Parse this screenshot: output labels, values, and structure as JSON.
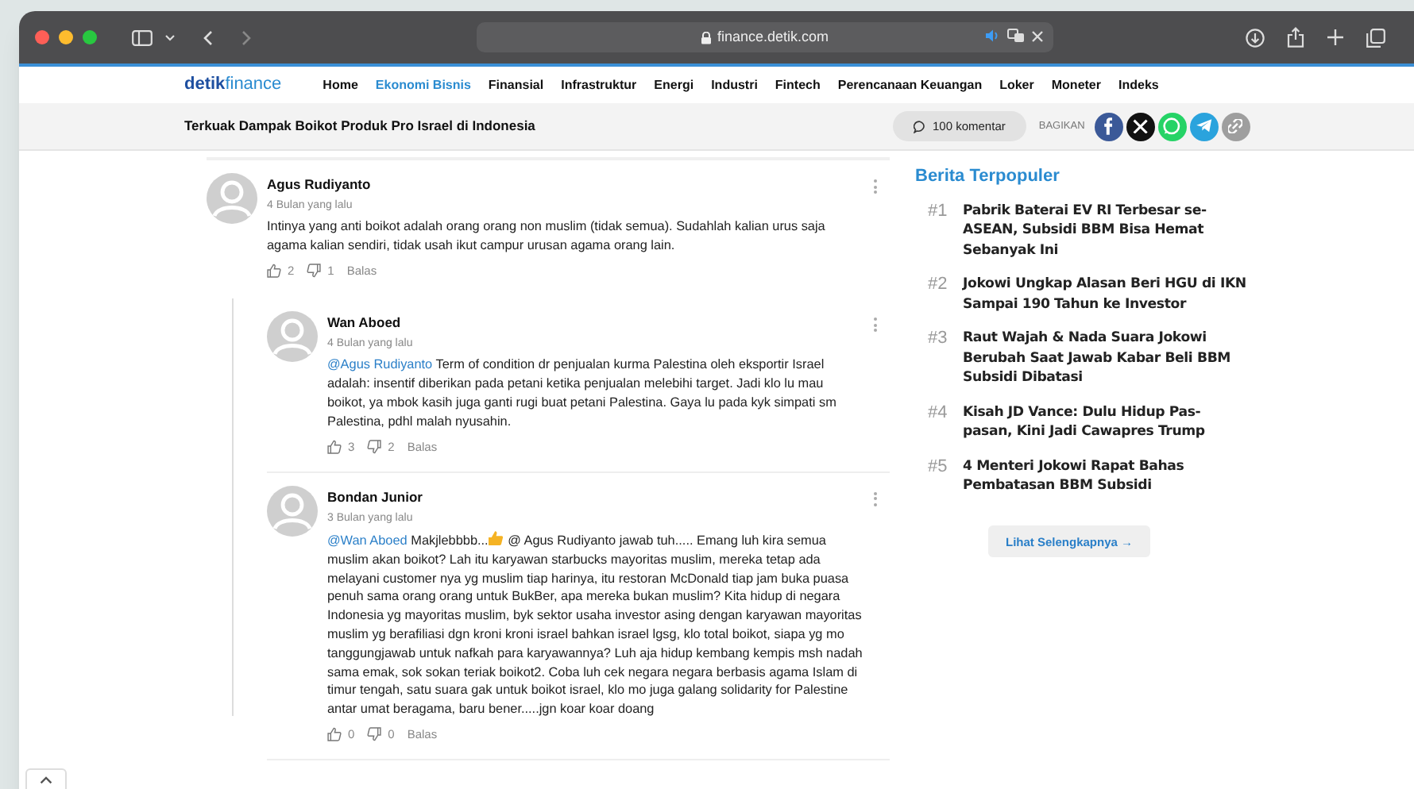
{
  "browser": {
    "url": "finance.detik.com"
  },
  "site": {
    "logo_bold": "detik",
    "logo_light": "finance",
    "nav": [
      {
        "label": "Home",
        "selected": false
      },
      {
        "label": "Ekonomi Bisnis",
        "selected": true
      },
      {
        "label": "Finansial",
        "selected": false
      },
      {
        "label": "Infrastruktur",
        "selected": false
      },
      {
        "label": "Energi",
        "selected": false
      },
      {
        "label": "Industri",
        "selected": false
      },
      {
        "label": "Fintech",
        "selected": false
      },
      {
        "label": "Perencanaan Keuangan",
        "selected": false
      },
      {
        "label": "Loker",
        "selected": false
      },
      {
        "label": "Moneter",
        "selected": false
      },
      {
        "label": "Indeks",
        "selected": false
      }
    ]
  },
  "article_bar": {
    "title": "Terkuak Dampak Boikot Produk Pro Israel di Indonesia",
    "comments_button": "100 komentar",
    "share_label": "BAGIKAN",
    "share_buttons": [
      {
        "kind": "facebook",
        "color": "#3b5998"
      },
      {
        "kind": "x",
        "color": "#111111"
      },
      {
        "kind": "whatsapp",
        "color": "#25d366"
      },
      {
        "kind": "telegram",
        "color": "#2aa3dd"
      },
      {
        "kind": "link",
        "color": "#9e9e9e"
      }
    ]
  },
  "comments": [
    {
      "author": "Agus Rudiyanto",
      "time": "4 Bulan yang lalu",
      "parts": [
        {
          "kind": "text",
          "text": "Intinya yang anti boikot adalah orang orang non muslim (tidak semua). Sudahlah kalian urus saja agama kalian sendiri, tidak usah ikut campur urusan agama orang lain."
        }
      ],
      "likes": "2",
      "dislikes": "1",
      "reply": "Balas",
      "replies": [
        {
          "author": "Wan Aboed",
          "time": "4 Bulan yang lalu",
          "parts": [
            {
              "kind": "mention",
              "text": "@Agus Rudiyanto"
            },
            {
              "kind": "text",
              "text": " Term of condition dr penjualan kurma Palestina oleh eksportir Israel adalah: insentif diberikan pada petani ketika penjualan melebihi target. Jadi klo lu mau boikot, ya mbok kasih juga ganti rugi buat petani Palestina. Gaya lu pada kyk simpati sm Palestina, pdhl malah nyusahin."
            }
          ],
          "likes": "3",
          "dislikes": "2",
          "reply": "Balas"
        },
        {
          "author": "Bondan Junior",
          "time": "3 Bulan yang lalu",
          "parts": [
            {
              "kind": "mention",
              "text": "@Wan Aboed"
            },
            {
              "kind": "text",
              "text": " Makjlebbbb..."
            },
            {
              "kind": "thumb"
            },
            {
              "kind": "text",
              "text": " @ Agus Rudiyanto jawab tuh..... Emang luh kira semua muslim akan boikot? Lah itu karyawan starbucks mayoritas muslim, mereka tetap ada melayani customer nya yg muslim tiap harinya, itu restoran McDonald tiap jam buka puasa penuh sama orang orang untuk BukBer, apa mereka bukan muslim? Kita hidup di negara Indonesia yg mayoritas muslim, byk sektor usaha investor asing dengan karyawan mayoritas muslim yg berafiliasi dgn kroni kroni israel bahkan israel lgsg, klo total boikot, siapa yg mo tanggungjawab untuk nafkah para karyawannya? Luh aja hidup kembang kempis msh nadah sama emak, sok sokan teriak boikot2. Coba luh cek negara negara berbasis agama Islam di timur tengah, satu suara gak untuk boikot israel, klo mo juga galang solidarity for Palestine antar umat beragama, baru bener.....jgn koar koar doang"
            }
          ],
          "likes": "0",
          "dislikes": "0",
          "reply": "Balas"
        }
      ]
    }
  ],
  "sidebar": {
    "title": "Berita Terpopuler",
    "items": [
      {
        "rank": "#1",
        "title": "Pabrik Baterai EV RI Terbesar se-ASEAN, Subsidi BBM Bisa Hemat Sebanyak Ini"
      },
      {
        "rank": "#2",
        "title": "Jokowi Ungkap Alasan Beri HGU di IKN Sampai 190 Tahun ke Investor"
      },
      {
        "rank": "#3",
        "title": "Raut Wajah & Nada Suara Jokowi Berubah Saat Jawab Kabar Beli BBM Subsidi Dibatasi"
      },
      {
        "rank": "#4",
        "title": "Kisah JD Vance: Dulu Hidup Pas-pasan, Kini Jadi Cawapres Trump"
      },
      {
        "rank": "#5",
        "title": "4 Menteri Jokowi Rapat Bahas Pembatasan BBM Subsidi"
      }
    ],
    "more_button": "Lihat Selengkapnya →"
  }
}
